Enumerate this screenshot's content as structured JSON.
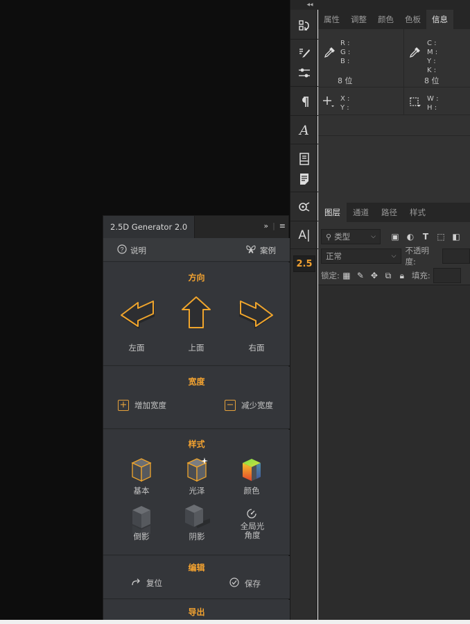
{
  "toolstrip": {
    "collapse_label": "◂◂",
    "badge_label": "2.5"
  },
  "info_panel": {
    "tabs": [
      "属性",
      "调整",
      "颜色",
      "色板",
      "信息"
    ],
    "active_tab": "信息",
    "rgb_labels": "R :\nG :\nB :",
    "cmyk_labels": "C :\nM :\nY :\nK :",
    "bits_left": "8 位",
    "bits_right": "8 位",
    "xy_labels": "X :\nY :",
    "wh_labels": "W :\nH :"
  },
  "layers_panel": {
    "tabs": [
      "图层",
      "通道",
      "路径",
      "样式"
    ],
    "active_tab": "图层",
    "filter_placeholder": "类型",
    "blend_mode": "正常",
    "opacity_label": "不透明度:",
    "lock_label": "锁定:",
    "fill_label": "填充:"
  },
  "plugin": {
    "title": "2.5D Generator 2.0",
    "menu_expand": "»",
    "menu_list": "≡",
    "help_label": "说明",
    "cases_label": "案例",
    "direction": {
      "title": "方向",
      "left": "左面",
      "top": "上面",
      "right": "右面"
    },
    "width": {
      "title": "宽度",
      "increase": "增加宽度",
      "decrease": "减少宽度"
    },
    "style": {
      "title": "样式",
      "basic": "基本",
      "gloss": "光泽",
      "color": "颜色",
      "reflection": "倒影",
      "shadow": "阴影",
      "global_light_line1": "全局光",
      "global_light_line2": "角度"
    },
    "edit": {
      "title": "编辑",
      "reset": "复位",
      "save": "保存"
    },
    "export": {
      "title": "导出"
    }
  },
  "colors": {
    "accent": "#f4a330",
    "panel_bg": "#303235",
    "canvas_bg": "#0d0d0d"
  }
}
